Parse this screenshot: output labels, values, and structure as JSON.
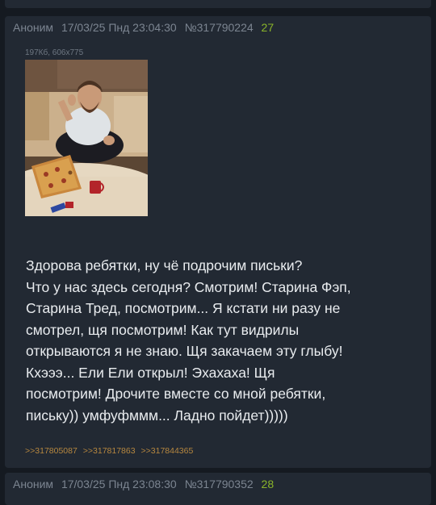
{
  "posts": [
    {
      "author": "Аноним",
      "datetime": "17/03/25 Пнд 23:04:30",
      "number": "№317790224",
      "reply_count": "27",
      "file_info": "197Кб, 606x775",
      "image_icon": "photo-thumbnail",
      "text": "Здорова ребятки, ну чё подрочим письки?\nЧто у нас здесь сегодня? Смотрим! Старина Фэп,\nСтарина Тред, посмотрим... Я кстати ни разу не\nсмотрел, щя посмотрим! Как тут видрилы\nоткрываются я не знаю. Щя закачаем эту глыбу!\nКхэээ... Ели Ели открыл! Эхахаха! Щя\nпосмотрим! Дрочите вместе со мной ребятки,\nпиську)) умфуфммм... Ладно пойдет)))))",
      "replies": [
        ">>317805087",
        ">>317817863",
        ">>317844365"
      ]
    },
    {
      "author": "Аноним",
      "datetime": "17/03/25 Пнд 23:08:30",
      "number": "№317790352",
      "reply_count": "28"
    }
  ],
  "colors": {
    "background": "#151a21",
    "post_background": "#222933",
    "meta_text": "#7c8591",
    "reply_count": "#8ab42a",
    "reply_link": "#b6873f",
    "body_text": "#e9ecef"
  }
}
